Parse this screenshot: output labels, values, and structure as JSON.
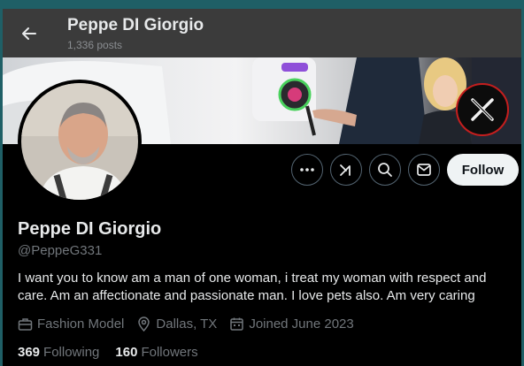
{
  "header": {
    "name": "Peppe DI Giorgio",
    "posts": "1,336 posts"
  },
  "profile": {
    "display_name": "Peppe DI Giorgio",
    "handle": "@PeppeG331",
    "bio": "I want you to know am a man of one woman, i treat my woman with respect and care. Am an affectionate and passionate man. I love pets also. Am very caring",
    "profession": "Fashion Model",
    "location": "Dallas, TX",
    "joined": "Joined June 2023",
    "following_count": "369",
    "following_label": "Following",
    "followers_count": "160",
    "followers_label": "Followers"
  },
  "actions": {
    "follow_label": "Follow"
  },
  "icons": [
    "back-arrow-icon",
    "more-icon",
    "grok-icon",
    "search-icon",
    "message-icon",
    "briefcase-icon",
    "location-pin-icon",
    "calendar-icon",
    "x-logo-icon"
  ],
  "colors": {
    "background": "#000000",
    "text_primary": "#e7e9ea",
    "text_secondary": "#71767b",
    "follow_button_bg": "#eff3f4",
    "logo_ring": "#c41e1e"
  }
}
